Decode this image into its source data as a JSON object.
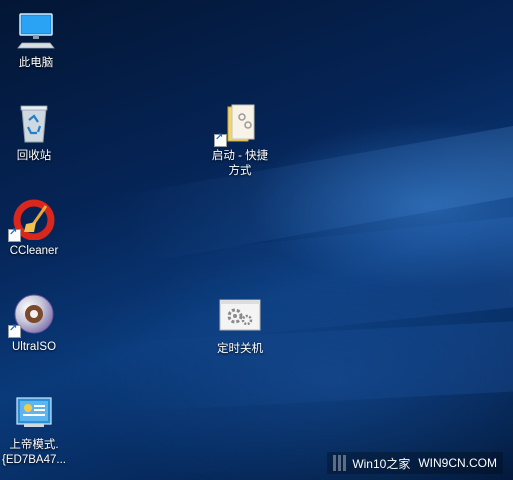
{
  "desktop": {
    "icons": [
      {
        "label": "此电脑"
      },
      {
        "label": "回收站"
      },
      {
        "label": "CCleaner"
      },
      {
        "label": "UltraISO"
      },
      {
        "label_line1": "上帝模式.",
        "label_line2": "{ED7BA47..."
      },
      {
        "label_line1": "启动 - 快捷",
        "label_line2": "方式"
      },
      {
        "label": "定时关机"
      }
    ]
  },
  "watermark": {
    "left": "Win10之家",
    "right": "WIN9CN.COM"
  }
}
